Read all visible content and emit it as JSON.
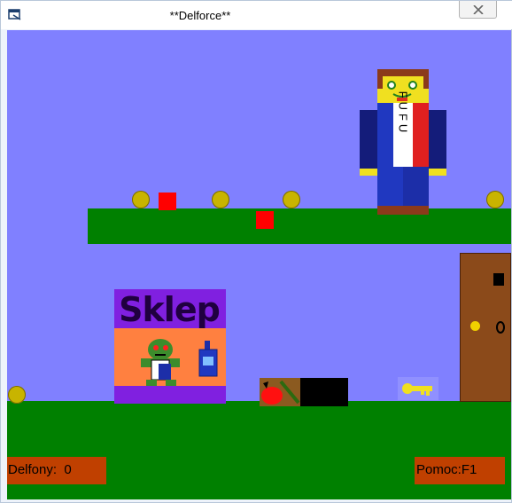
{
  "window": {
    "title": "**Delforce**",
    "icon": "window-icon",
    "close_icon": "close-icon"
  },
  "colors": {
    "sky": "#8080ff",
    "ground": "#008000",
    "hud": "#c04000",
    "coin": "#c8b400",
    "block": "#ff0000"
  },
  "game": {
    "shop_sign": "Sklep",
    "player_shirt_text": "FUFU",
    "hud": {
      "delfony_label": "Delfony:",
      "delfony_value": "0",
      "help": "Pomoc:F1"
    }
  }
}
